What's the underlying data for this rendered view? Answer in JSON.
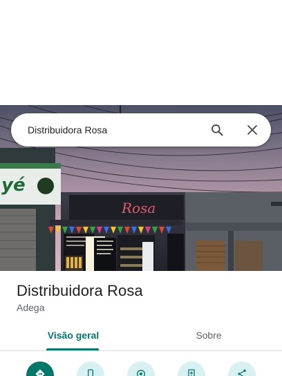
{
  "search": {
    "query": "Distribuidora Rosa",
    "search_icon": "search-icon",
    "close_icon": "close-icon"
  },
  "photo": {
    "sign_left_text": "yé",
    "sign_right_text": "Rosa"
  },
  "place": {
    "name": "Distribuidora Rosa",
    "category": "Adega"
  },
  "tabs": [
    {
      "label": "Visão geral",
      "active": true
    },
    {
      "label": "Sobre",
      "active": false
    }
  ],
  "actions": [
    {
      "icon": "directions-icon"
    },
    {
      "icon": "phone-icon"
    },
    {
      "icon": "location-icon"
    },
    {
      "icon": "save-icon"
    },
    {
      "icon": "share-icon"
    }
  ],
  "colors": {
    "accent": "#00796b",
    "action_bg": "#d7f0f2"
  }
}
